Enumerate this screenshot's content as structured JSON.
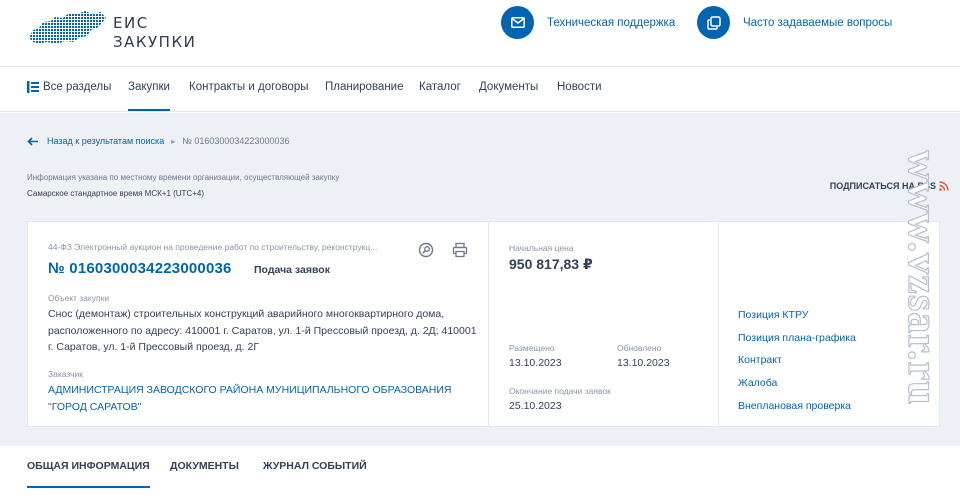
{
  "header": {
    "logo_line1": "ЕИС",
    "logo_line2": "ЗАКУПКИ",
    "support_label": "Техническая поддержка",
    "faq_label": "Часто задаваемые вопросы"
  },
  "nav": {
    "all_sections": "Все разделы",
    "items": [
      "Закупки",
      "Контракты и договоры",
      "Планирование",
      "Каталог",
      "Документы",
      "Новости"
    ]
  },
  "breadcrumb": {
    "back_label": "Назад к результатам поиска",
    "separator": "▸",
    "current": "№ 0160300034223000036"
  },
  "timezone": {
    "note": "Информация указана по местному времени организации, осуществляющей закупку",
    "value": "Самарское стандартное время МСК+1 (UTC+4)"
  },
  "subscribe_rss": "ПОДПИСАТЬСЯ НА RSS",
  "procurement": {
    "type": "44-ФЗ Электронный аукцион на проведение работ по строительству, реконструкц...",
    "number": "№ 0160300034223000036",
    "status": "Подача заявок",
    "object_label": "Объект закупки",
    "object_text": "Снос (демонтаж) строительных конструкций аварийного многоквартирного дома, расположенного по адресу: 410001 г. Саратов, ул. 1-й Прессовый проезд, д. 2Д; 410001 г. Саратов, ул. 1-й Прессовый проезд, д. 2Г",
    "customer_label": "Заказчик",
    "customer_text": "АДМИНИСТРАЦИЯ ЗАВОДСКОГО РАЙОНА МУНИЦИПАЛЬНОГО ОБРАЗОВАНИЯ \"ГОРОД САРАТОВ\"",
    "initial_price_label": "Начальная цена",
    "initial_price": "950 817,83 ₽",
    "placed_label": "Размещено",
    "placed_date": "13.10.2023",
    "updated_label": "Обновлено",
    "updated_date": "13.10.2023",
    "deadline_label": "Окончание подачи заявок",
    "deadline_date": "25.10.2023"
  },
  "side_links": [
    "Позиция КТРУ",
    "Позиция плана-графика",
    "Контракт",
    "Жалоба",
    "Внеплановая проверка"
  ],
  "tabs": [
    "ОБЩАЯ ИНФОРМАЦИЯ",
    "ДОКУМЕНТЫ",
    "ЖУРНАЛ СОБЫТИЙ"
  ],
  "watermark": "www.vzsar.ru",
  "colors": {
    "accent": "#0065b1",
    "text": "#334059",
    "muted": "#8a94a6",
    "background": "#edf0f5",
    "rss": "#e8562a"
  },
  "icons": [
    "russia-map-logo",
    "mail-icon",
    "copy-icon",
    "sections-icon",
    "arrow-left-icon",
    "search-doc-icon",
    "print-icon",
    "rss-icon"
  ]
}
